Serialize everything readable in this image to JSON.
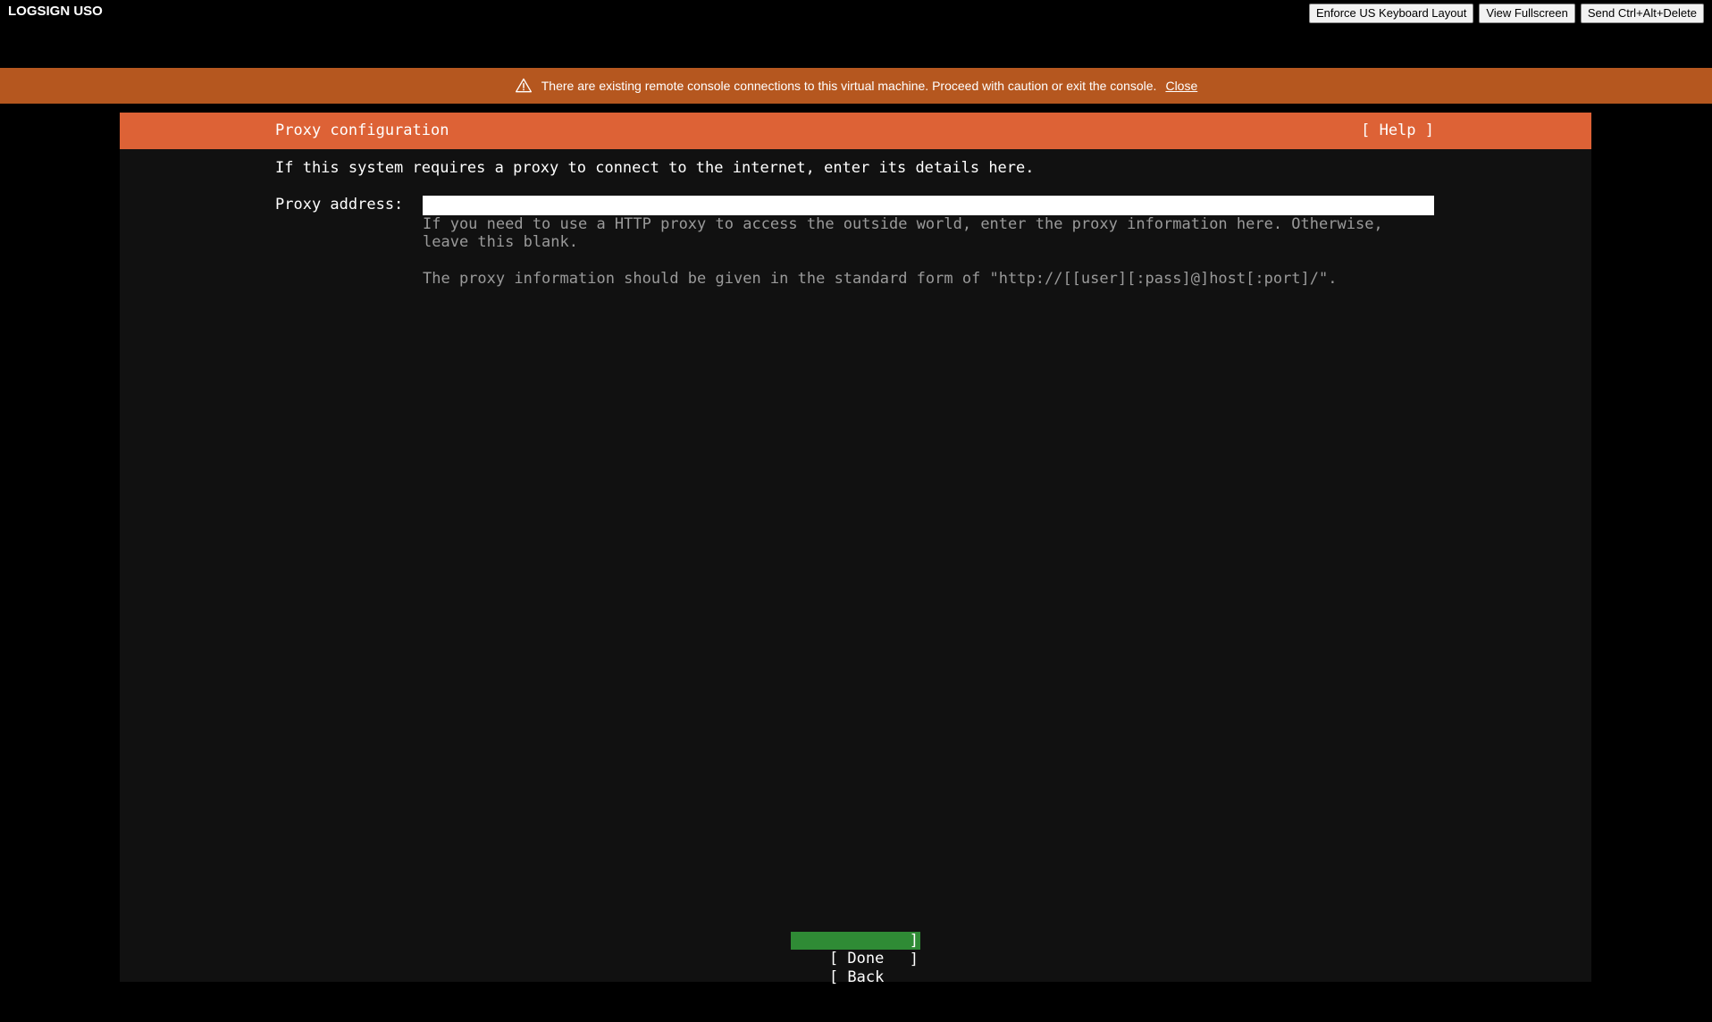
{
  "app": {
    "title": "LOGSIGN USO"
  },
  "toolbar": {
    "keyboard_label": "Enforce US Keyboard Layout",
    "fullscreen_label": "View Fullscreen",
    "cad_label": "Send Ctrl+Alt+Delete"
  },
  "banner": {
    "message": "There are existing remote console connections to this virtual machine. Proceed with caution or exit the console.",
    "close_label": "Close",
    "icon": "warning-icon"
  },
  "installer": {
    "title": "Proxy configuration",
    "help_label": "[ Help ]",
    "intro": "If this system requires a proxy to connect to the internet, enter its details here.",
    "proxy_label": "Proxy address:",
    "proxy_value": "",
    "help_line_1": "If you need to use a HTTP proxy to access the outside world, enter the proxy information here. Otherwise,",
    "help_line_2": "leave this blank.",
    "help_line_3": "The proxy information should be given in the standard form of \"http://[[user][:pass]@]host[:port]/\".",
    "done_label": "[ Done",
    "back_label": "[ Back",
    "bracket_close": "]"
  },
  "colors": {
    "banner": "#b5571f",
    "header": "#dd6236",
    "done_highlight": "#2f8b35",
    "console_bg": "#111111"
  }
}
